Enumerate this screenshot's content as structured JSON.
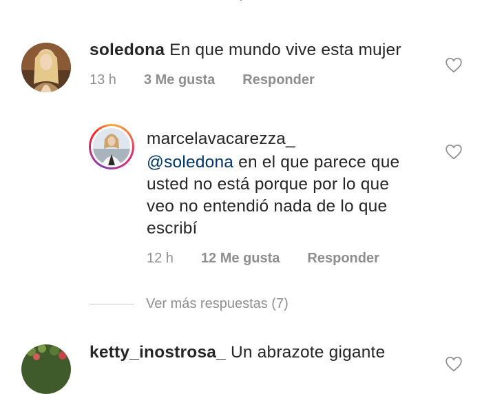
{
  "comments": [
    {
      "username": "soledona",
      "text": "En que mundo vive esta mujer",
      "time": "13 h",
      "likes": "3 Me gusta",
      "reply": "Responder"
    },
    {
      "username": "marcelavacarezza_",
      "mention": "@soledona",
      "text_line1": "en el que parece que",
      "text_line2": "usted no está porque por lo que",
      "text_line3": "veo no entendió nada de lo que",
      "text_line4": "escribí",
      "time": "12 h",
      "likes": "12 Me gusta",
      "reply": "Responder"
    },
    {
      "username": "ketty_inostrosa_",
      "text": "Un abrazote gigante"
    }
  ],
  "more_replies": "Ver más respuestas (7)",
  "colors": {
    "text": "#262626",
    "muted": "#8e8e8e",
    "mention": "#00376b"
  }
}
